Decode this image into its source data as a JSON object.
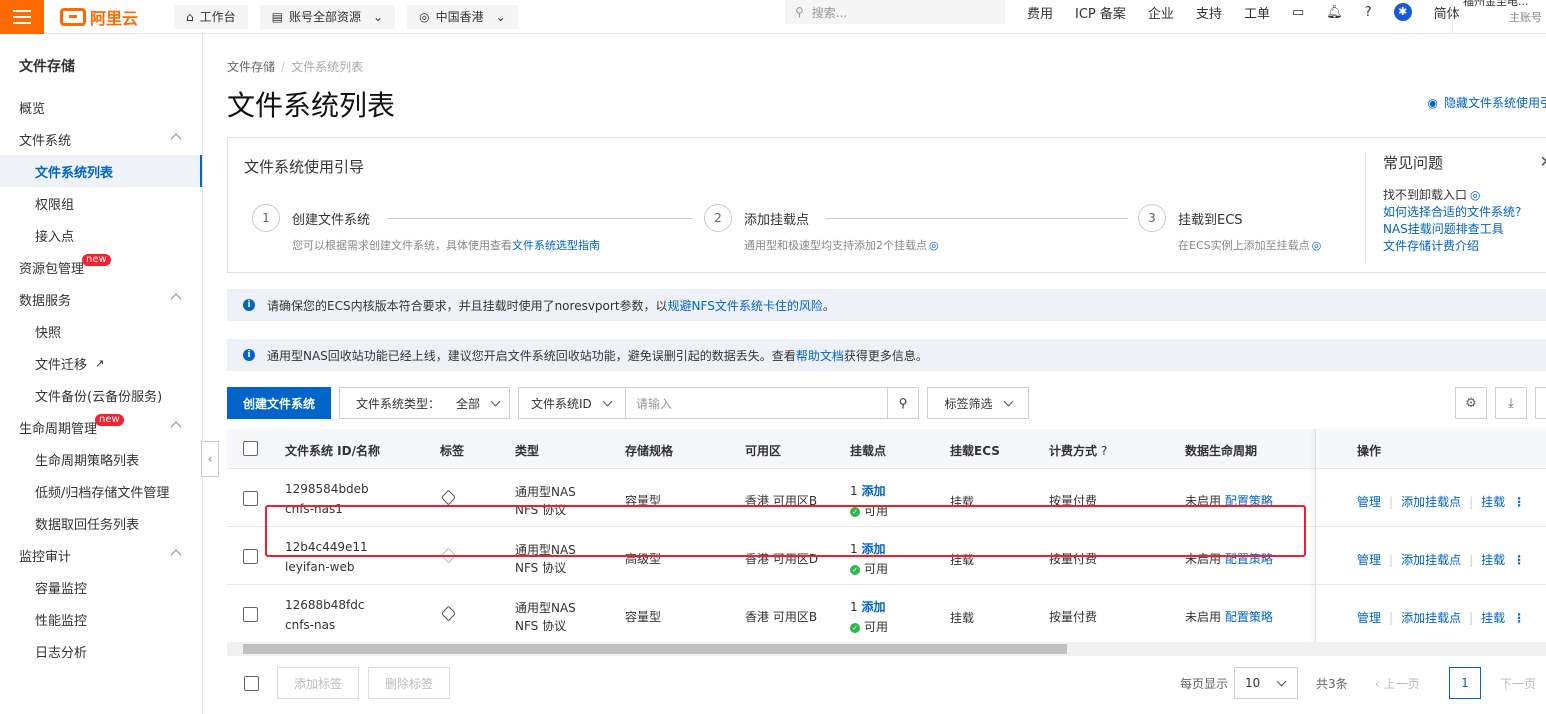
{
  "topbar": {
    "logo": "阿里云",
    "workbench": "工作台",
    "resources": "账号全部资源",
    "region": "中国香港",
    "search_placeholder": "搜索...",
    "links": [
      "费用",
      "ICP 备案",
      "企业",
      "支持",
      "工单"
    ],
    "lang": "简体",
    "account_name": "福州金至电...",
    "account_type": "主账号"
  },
  "sidebar": {
    "title": "文件存储",
    "items": [
      {
        "label": "概览"
      },
      {
        "label": "文件系统"
      },
      {
        "label": "文件系统列表"
      },
      {
        "label": "权限组"
      },
      {
        "label": "接入点"
      },
      {
        "label": "资源包管理",
        "badge": "new"
      },
      {
        "label": "数据服务"
      },
      {
        "label": "快照"
      },
      {
        "label": "文件迁移"
      },
      {
        "label": "文件备份(云备份服务)"
      },
      {
        "label": "生命周期管理",
        "badge": "new"
      },
      {
        "label": "生命周期策略列表"
      },
      {
        "label": "低频/归档存储文件管理"
      },
      {
        "label": "数据取回任务列表"
      },
      {
        "label": "监控审计"
      },
      {
        "label": "容量监控"
      },
      {
        "label": "性能监控"
      },
      {
        "label": "日志分析"
      }
    ]
  },
  "breadcrumb": {
    "root": "文件存储",
    "current": "文件系统列表"
  },
  "page_title": "文件系统列表",
  "hide_guide": "隐藏文件系统使用引",
  "guide": {
    "title": "文件系统使用引导",
    "steps": [
      {
        "num": "1",
        "label": "创建文件系统",
        "desc": "您可以根据需求创建文件系统，具体使用查看",
        "link": "文件系统选型指南"
      },
      {
        "num": "2",
        "label": "添加挂载点",
        "desc": "通用型和极速型均支持添加2个挂载点"
      },
      {
        "num": "3",
        "label": "挂载到ECS",
        "desc": "在ECS实例上添加至挂载点"
      }
    ],
    "faq_title": "常见问题",
    "faq": [
      "找不到卸载入口",
      "如何选择合适的文件系统?",
      "NAS挂载问题排查工具",
      "文件存储计费介绍"
    ]
  },
  "notices": [
    {
      "text": "请确保您的ECS内核版本符合要求，并且挂载时使用了noresvport参数，以",
      "link": "规避NFS文件系统卡住的风险",
      "tail": "。"
    },
    {
      "text": "通用型NAS回收站功能已经上线，建议您开启文件系统回收站功能，避免误删引起的数据丢失。查看",
      "link": "帮助文档",
      "tail": "获得更多信息。"
    }
  ],
  "toolbar": {
    "create": "创建文件系统",
    "type_label": "文件系统类型：",
    "type_value": "全部",
    "id_select": "文件系统ID",
    "search_placeholder": "请输入",
    "tag_filter": "标签筛选"
  },
  "table": {
    "headers": [
      "文件系统 ID/名称",
      "标签",
      "类型",
      "存储规格",
      "可用区",
      "挂载点",
      "挂载ECS",
      "计费方式",
      "数据生命周期",
      "操作"
    ],
    "rows": [
      {
        "id": "1298584bdeb",
        "name": "cnfs-nas1",
        "type1": "通用型NAS",
        "type2": "NFS 协议",
        "spec": "容量型",
        "zone": "香港 可用区B",
        "mount_count": "1",
        "mount_add": "添加",
        "mount_status": "可用",
        "ecs": "挂载",
        "billing": "按量付费",
        "lifecycle": "未启用",
        "lifecycle_link": "配置策略",
        "op1": "管理",
        "op2": "添加挂载点",
        "op3": "挂载"
      },
      {
        "id": "12b4c449e11",
        "name": "leyifan-web",
        "type1": "通用型NAS",
        "type2": "NFS 协议",
        "spec": "高级型",
        "zone": "香港 可用区D",
        "mount_count": "1",
        "mount_add": "添加",
        "mount_status": "可用",
        "ecs": "挂载",
        "billing": "按量付费",
        "lifecycle": "未启用",
        "lifecycle_link": "配置策略",
        "op1": "管理",
        "op2": "添加挂载点",
        "op3": "挂载"
      },
      {
        "id": "12688b48fdc",
        "name": "cnfs-nas",
        "type1": "通用型NAS",
        "type2": "NFS 协议",
        "spec": "容量型",
        "zone": "香港 可用区B",
        "mount_count": "1",
        "mount_add": "添加",
        "mount_status": "可用",
        "ecs": "挂载",
        "billing": "按量付费",
        "lifecycle": "未启用",
        "lifecycle_link": "配置策略",
        "op1": "管理",
        "op2": "添加挂载点",
        "op3": "挂载"
      }
    ]
  },
  "footer": {
    "add_tag": "添加标签",
    "remove_tag": "删除标签",
    "per_page_label": "每页显示",
    "per_page": "10",
    "total": "共3条",
    "prev": "上一页",
    "page": "1",
    "next": "下一页"
  }
}
